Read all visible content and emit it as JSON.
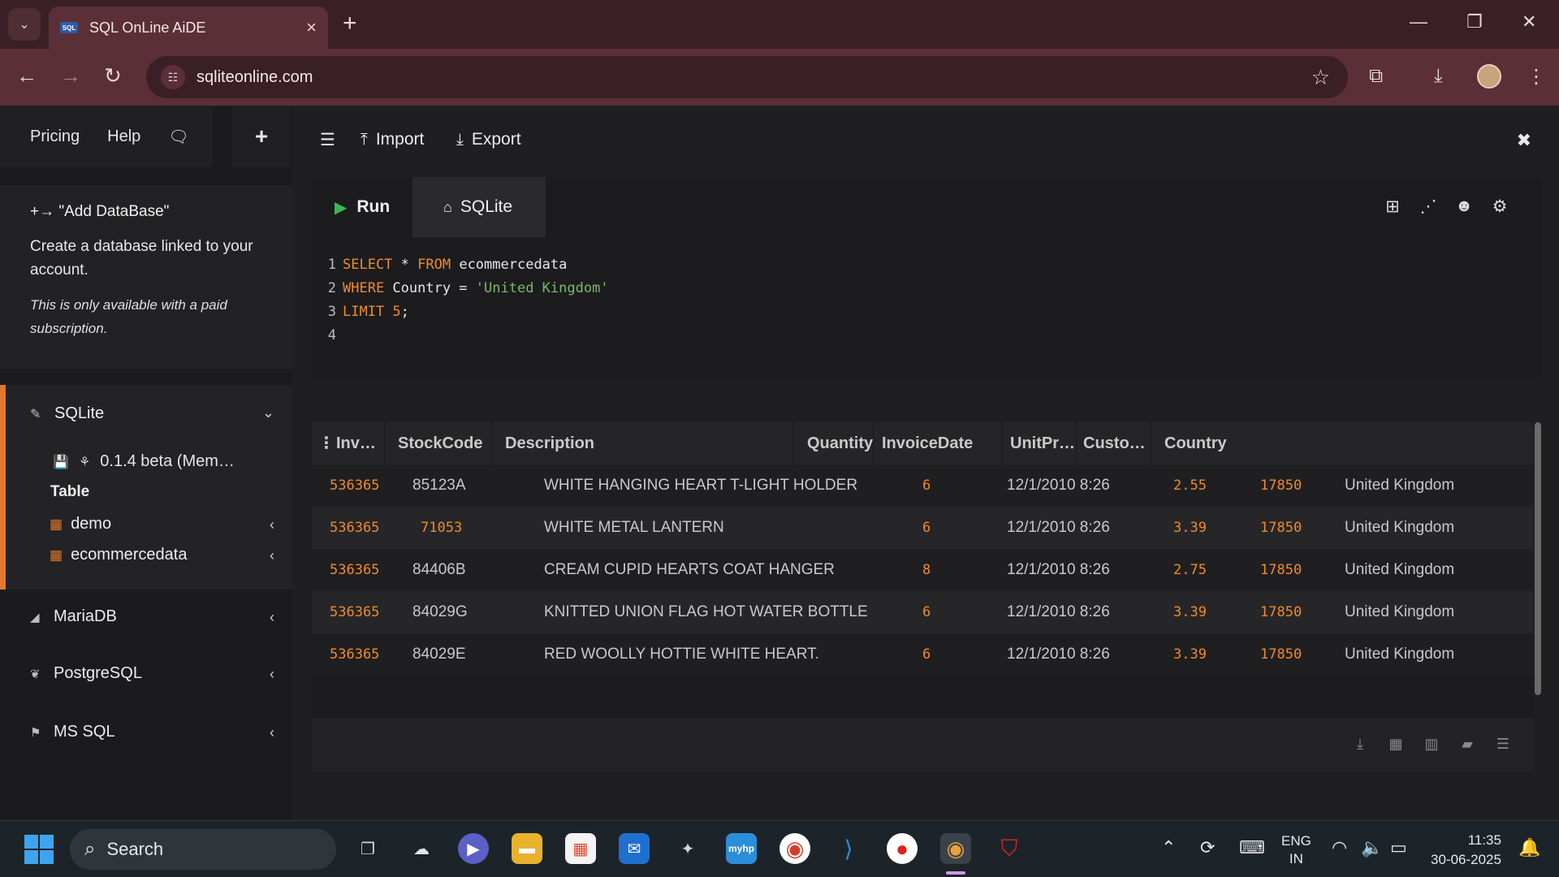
{
  "browser": {
    "tab_title": "SQL OnLine AiDE",
    "favicon_text": "SQL",
    "url": "sqliteonline.com"
  },
  "sidebar": {
    "top_links": [
      "Pricing",
      "Help"
    ],
    "add_db": {
      "title": "+→ \"Add DataBase\"",
      "description": "Create a database linked to your account.",
      "note": "This is only available with a paid subscription."
    },
    "sqlite": {
      "label": "SQLite",
      "version": "0.1.4 beta (Mem…",
      "table_header": "Table",
      "tables": [
        "demo",
        "ecommercedata"
      ]
    },
    "databases": [
      "MariaDB",
      "PostgreSQL",
      "MS SQL"
    ]
  },
  "toolbar": {
    "import_label": "Import",
    "export_label": "Export"
  },
  "editor": {
    "run_label": "Run",
    "engine_tab": "SQLite",
    "line_numbers": [
      "1",
      "2",
      "3",
      "4"
    ],
    "code": {
      "l1_kw1": "SELECT",
      "l1_star": " * ",
      "l1_kw2": "FROM",
      "l1_id": " ecommercedata",
      "l2_kw": "WHERE",
      "l2_id": " Country = ",
      "l2_str": "'United Kingdom'",
      "l3_kw": "LIMIT",
      "l3_num": " 5",
      "l3_semi": ";"
    }
  },
  "results": {
    "columns": [
      "Inv…",
      "StockCode",
      "Description",
      "Quantity",
      "InvoiceDate",
      "UnitPr…",
      "Custo…",
      "Country"
    ],
    "rows": [
      [
        "536365",
        "85123A",
        "WHITE HANGING HEART T-LIGHT HOLDER",
        "6",
        "12/1/2010 8:26",
        "2.55",
        "17850",
        "United Kingdom"
      ],
      [
        "536365",
        "71053",
        "WHITE METAL LANTERN",
        "6",
        "12/1/2010 8:26",
        "3.39",
        "17850",
        "United Kingdom"
      ],
      [
        "536365",
        "84406B",
        "CREAM CUPID HEARTS COAT HANGER",
        "8",
        "12/1/2010 8:26",
        "2.75",
        "17850",
        "United Kingdom"
      ],
      [
        "536365",
        "84029G",
        "KNITTED UNION FLAG HOT WATER BOTTLE",
        "6",
        "12/1/2010 8:26",
        "3.39",
        "17850",
        "United Kingdom"
      ],
      [
        "536365",
        "84029E",
        "RED WOOLLY HOTTIE WHITE HEART.",
        "6",
        "12/1/2010 8:26",
        "3.39",
        "17850",
        "United Kingdom"
      ]
    ]
  },
  "taskbar": {
    "search_label": "Search",
    "lang_top": "ENG",
    "lang_bottom": "IN",
    "time": "11:35",
    "date": "30-06-2025"
  },
  "colors": {
    "accent": "#e4782a",
    "run_green": "#3cb850",
    "browser_frame": "#5b2f37"
  }
}
